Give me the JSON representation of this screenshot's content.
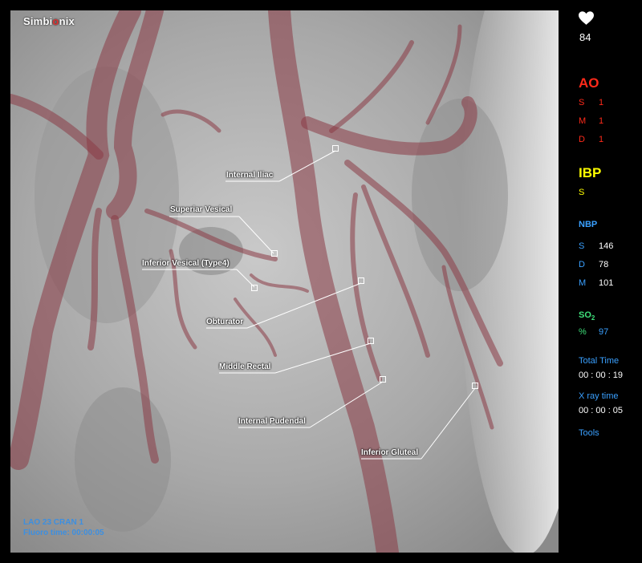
{
  "brand": {
    "name_part1": "Simbi",
    "name_dot": "o",
    "name_part2": "nix"
  },
  "view": {
    "angle": "LAO  23 CRAN   1",
    "fluoro_time": "Fluoro time:  00:00:05"
  },
  "callouts": [
    {
      "id": "internal-iliac",
      "label": "Internal Iliac"
    },
    {
      "id": "superior-vesical",
      "label": "Superiar Vesical"
    },
    {
      "id": "inferior-vesical",
      "label": "Inferior Vesical (Type4)"
    },
    {
      "id": "obturator",
      "label": "Obturator"
    },
    {
      "id": "middle-rectal",
      "label": "Middle Rectal"
    },
    {
      "id": "internal-pudendal",
      "label": "Internal Pudendal"
    },
    {
      "id": "inferior-gluteal",
      "label": "Inferior Gluteal"
    }
  ],
  "vitals": {
    "heart_rate": "84",
    "ao": {
      "title": "AO",
      "color": "#ff2a1a",
      "rows": [
        {
          "key": "S",
          "value": "1"
        },
        {
          "key": "M",
          "value": "1"
        },
        {
          "key": "D",
          "value": "1"
        }
      ]
    },
    "ibp": {
      "title": "IBP",
      "color": "#ffff00",
      "row_key": "S"
    },
    "nbp": {
      "title": "NBP",
      "color": "#3aa0ff",
      "rows": [
        {
          "key": "S",
          "value": "146"
        },
        {
          "key": "D",
          "value": "78"
        },
        {
          "key": "M",
          "value": "101"
        }
      ]
    },
    "so2": {
      "title": "SO",
      "subscript": "2",
      "color": "#3fe07a",
      "key": "%",
      "value": "97"
    },
    "total_time": {
      "label": "Total Time",
      "value": "00 : 00 : 19"
    },
    "xray_time": {
      "label": "X ray time",
      "value": "00 : 00 : 05"
    },
    "tools_label": "Tools"
  }
}
